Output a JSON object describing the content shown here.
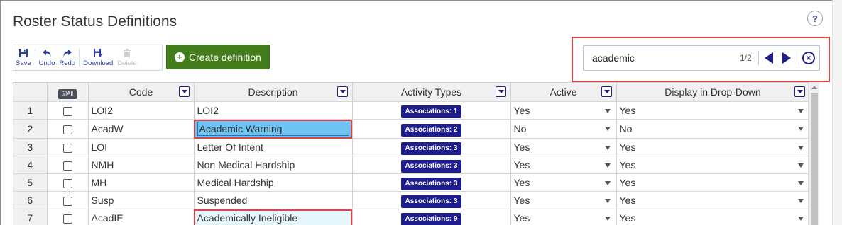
{
  "page": {
    "title": "Roster Status Definitions",
    "help_label": "?"
  },
  "toolbar": {
    "save": "Save",
    "undo": "Undo",
    "redo": "Redo",
    "download": "Download",
    "delete": "Delete",
    "create_label": "Create definition"
  },
  "search": {
    "value": "academic",
    "count": "1/2"
  },
  "grid": {
    "all_label": "All",
    "columns": {
      "code": "Code",
      "description": "Description",
      "activity_types": "Activity Types",
      "active": "Active",
      "display": "Display in Drop-Down"
    },
    "rows": [
      {
        "num": "1",
        "code": "LOI2",
        "description": "LOI2",
        "assoc": "Associations: 1",
        "active": "Yes",
        "display": "Yes"
      },
      {
        "num": "2",
        "code": "AcadW",
        "description": "Academic Warning",
        "assoc": "Associations: 2",
        "active": "No",
        "display": "No"
      },
      {
        "num": "3",
        "code": "LOI",
        "description": "Letter Of Intent",
        "assoc": "Associations: 3",
        "active": "Yes",
        "display": "Yes"
      },
      {
        "num": "4",
        "code": "NMH",
        "description": "Non Medical Hardship",
        "assoc": "Associations: 3",
        "active": "Yes",
        "display": "Yes"
      },
      {
        "num": "5",
        "code": "MH",
        "description": "Medical Hardship",
        "assoc": "Associations: 3",
        "active": "Yes",
        "display": "Yes"
      },
      {
        "num": "6",
        "code": "Susp",
        "description": "Suspended",
        "assoc": "Associations: 3",
        "active": "Yes",
        "display": "Yes"
      },
      {
        "num": "7",
        "code": "AcadIE",
        "description": "Academically Ineligible",
        "assoc": "Associations: 9",
        "active": "Yes",
        "display": "Yes"
      }
    ]
  },
  "colors": {
    "accent": "#1d1d8e",
    "create": "#447d1b",
    "highlight": "#e0444a",
    "current_match": "#6cc4f2"
  }
}
